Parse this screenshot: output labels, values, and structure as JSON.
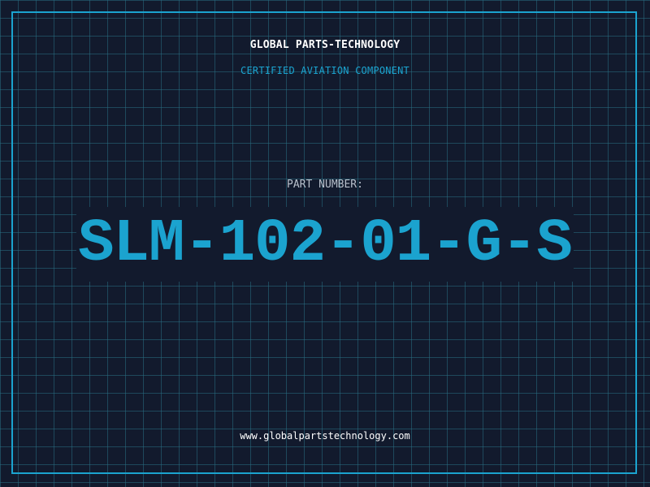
{
  "header": {
    "company": "GLOBAL PARTS-TECHNOLOGY",
    "subtitle": "CERTIFIED AVIATION COMPONENT"
  },
  "part": {
    "label": "PART NUMBER:",
    "number": "SLM-102-01-G-S"
  },
  "footer": {
    "url": "www.globalpartstechnology.com"
  },
  "colors": {
    "background": "#121a2d",
    "grid": "#286e82",
    "accent": "#1ba3cf",
    "text": "#ffffff",
    "muted": "#b8c0cc"
  }
}
